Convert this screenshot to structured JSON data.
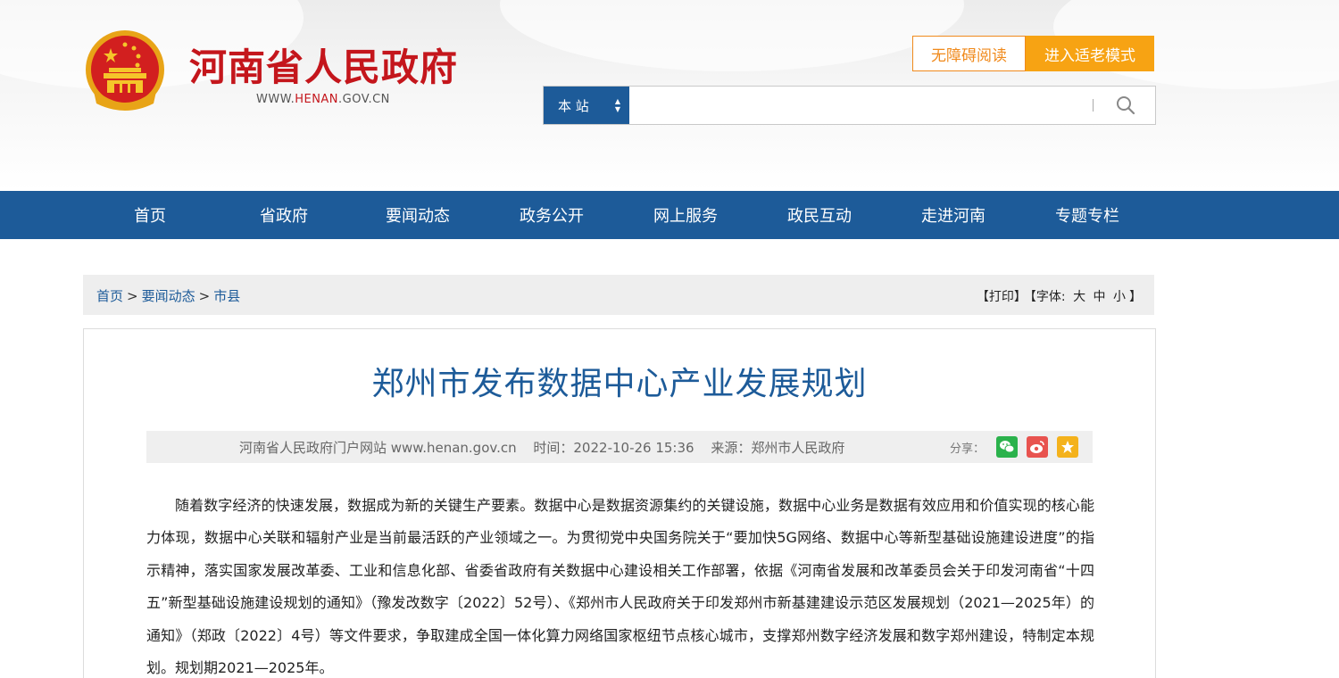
{
  "header": {
    "site_title": "河南省人民政府",
    "url_prefix": "WWW.",
    "url_highlight": "HENAN",
    "url_suffix": ".GOV.CN",
    "accessibility_button": "无障碍阅读",
    "elder_mode_button": "进入适老模式",
    "search": {
      "scope": "本 站",
      "placeholder": "",
      "value": ""
    }
  },
  "nav": {
    "items": [
      "首页",
      "省政府",
      "要闻动态",
      "政务公开",
      "网上服务",
      "政民互动",
      "走进河南",
      "专题专栏"
    ]
  },
  "breadcrumb": {
    "items": [
      "首页",
      "要闻动态",
      "市县"
    ],
    "separator": ">",
    "print": "【打印】",
    "font_label": "【字体:",
    "font_large": "大",
    "font_medium": "中",
    "font_small": "小",
    "font_close": "】"
  },
  "article": {
    "title": "郑州市发布数据中心产业发展规划",
    "site": "河南省人民政府门户网站 www.henan.gov.cn",
    "time": "时间：2022-10-26 15:36",
    "source": "来源：郑州市人民政府",
    "share_label": "分享：",
    "body": "随着数字经济的快速发展，数据成为新的关键生产要素。数据中心是数据资源集约的关键设施，数据中心业务是数据有效应用和价值实现的核心能力体现，数据中心关联和辐射产业是当前最活跃的产业领域之一。为贯彻党中央国务院关于“要加快5G网络、数据中心等新型基础设施建设进度”的指示精神，落实国家发展改革委、工业和信息化部、省委省政府有关数据中心建设相关工作部署，依据《河南省发展和改革委员会关于印发河南省“十四五”新型基础设施建设规划的通知》（豫发改数字〔2022〕52号）、《郑州市人民政府关于印发郑州市新基建建设示范区发展规划（2021—2025年）的通知》（郑政〔2022〕4号）等文件要求，争取建成全国一体化算力网络国家枢纽节点核心城市，支撑郑州数字经济发展和数字郑州建设，特制定本规划。规划期2021—2025年。"
  },
  "colors": {
    "brand_red": "#c4161c",
    "nav_blue": "#1d5b99",
    "orange": "#f7a313",
    "wechat_green": "#2bb24c",
    "weibo_red": "#e8534f",
    "favorite_gold": "#f4b21c"
  },
  "icons": [
    "national-emblem",
    "search-icon",
    "sort-arrows-icon",
    "wechat-icon",
    "weibo-icon",
    "star-icon"
  ]
}
